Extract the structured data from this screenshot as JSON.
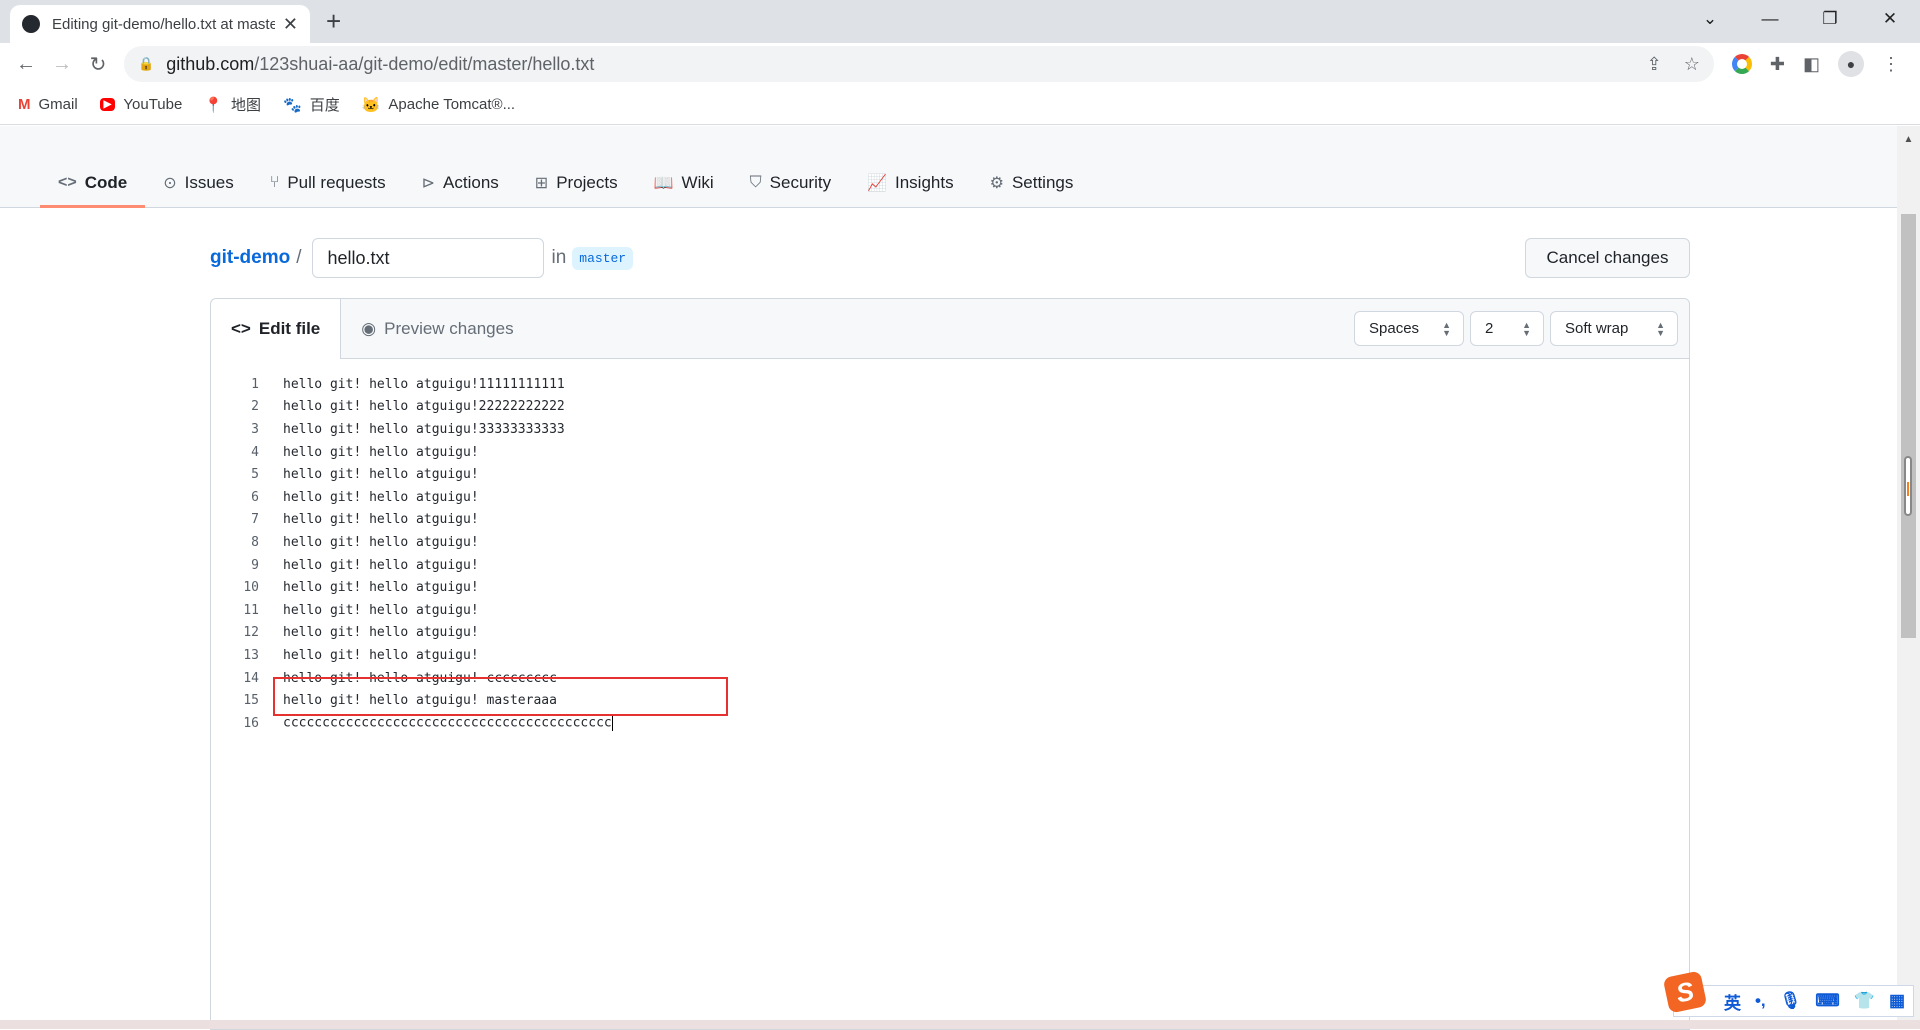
{
  "browser": {
    "tab_title": "Editing git-demo/hello.txt at master",
    "url_host": "github.com",
    "url_path": "/123shuai-aa/git-demo/edit/master/hello.txt",
    "bookmarks": [
      {
        "label": "Gmail",
        "icon": "gmail-icon"
      },
      {
        "label": "YouTube",
        "icon": "youtube-icon"
      },
      {
        "label": "地图",
        "icon": "maps-icon"
      },
      {
        "label": "百度",
        "icon": "baidu-icon"
      },
      {
        "label": "Apache Tomcat®...",
        "icon": "tomcat-icon"
      }
    ]
  },
  "repo_nav": [
    {
      "label": "Code",
      "icon": "code-icon",
      "selected": true
    },
    {
      "label": "Issues",
      "icon": "issue-icon"
    },
    {
      "label": "Pull requests",
      "icon": "pull-request-icon"
    },
    {
      "label": "Actions",
      "icon": "play-icon"
    },
    {
      "label": "Projects",
      "icon": "table-icon"
    },
    {
      "label": "Wiki",
      "icon": "book-icon"
    },
    {
      "label": "Security",
      "icon": "shield-icon"
    },
    {
      "label": "Insights",
      "icon": "graph-icon"
    },
    {
      "label": "Settings",
      "icon": "gear-icon"
    }
  ],
  "breadcrumb": {
    "repo": "git-demo",
    "separator": "/",
    "filename": "hello.txt",
    "in": "in",
    "branch": "master"
  },
  "cancel_label": "Cancel changes",
  "editor": {
    "tabs": [
      {
        "label": "Edit file",
        "selected": true
      },
      {
        "label": "Preview changes"
      }
    ],
    "indent_mode": "Spaces",
    "indent_size": "2",
    "wrap_mode": "Soft wrap",
    "lines": [
      "hello git! hello atguigu!11111111111",
      "hello git! hello atguigu!22222222222",
      "hello git! hello atguigu!33333333333",
      "hello git! hello atguigu!",
      "hello git! hello atguigu!",
      "hello git! hello atguigu!",
      "hello git! hello atguigu!",
      "hello git! hello atguigu!",
      "hello git! hello atguigu!",
      "hello git! hello atguigu!",
      "hello git! hello atguigu!",
      "hello git! hello atguigu!",
      "hello git! hello atguigu!",
      "hello git! hello atguigu! ccccccccc",
      "hello git! hello atguigu! masteraaa",
      "cccccccccccccccccccccccccccccccccccccccccc"
    ]
  },
  "ime": {
    "mode": "英",
    "punct": "•,"
  },
  "colors": {
    "accent": "#0969da",
    "nav_underline": "#fd8c73",
    "highlight_box": "#e5312f"
  }
}
